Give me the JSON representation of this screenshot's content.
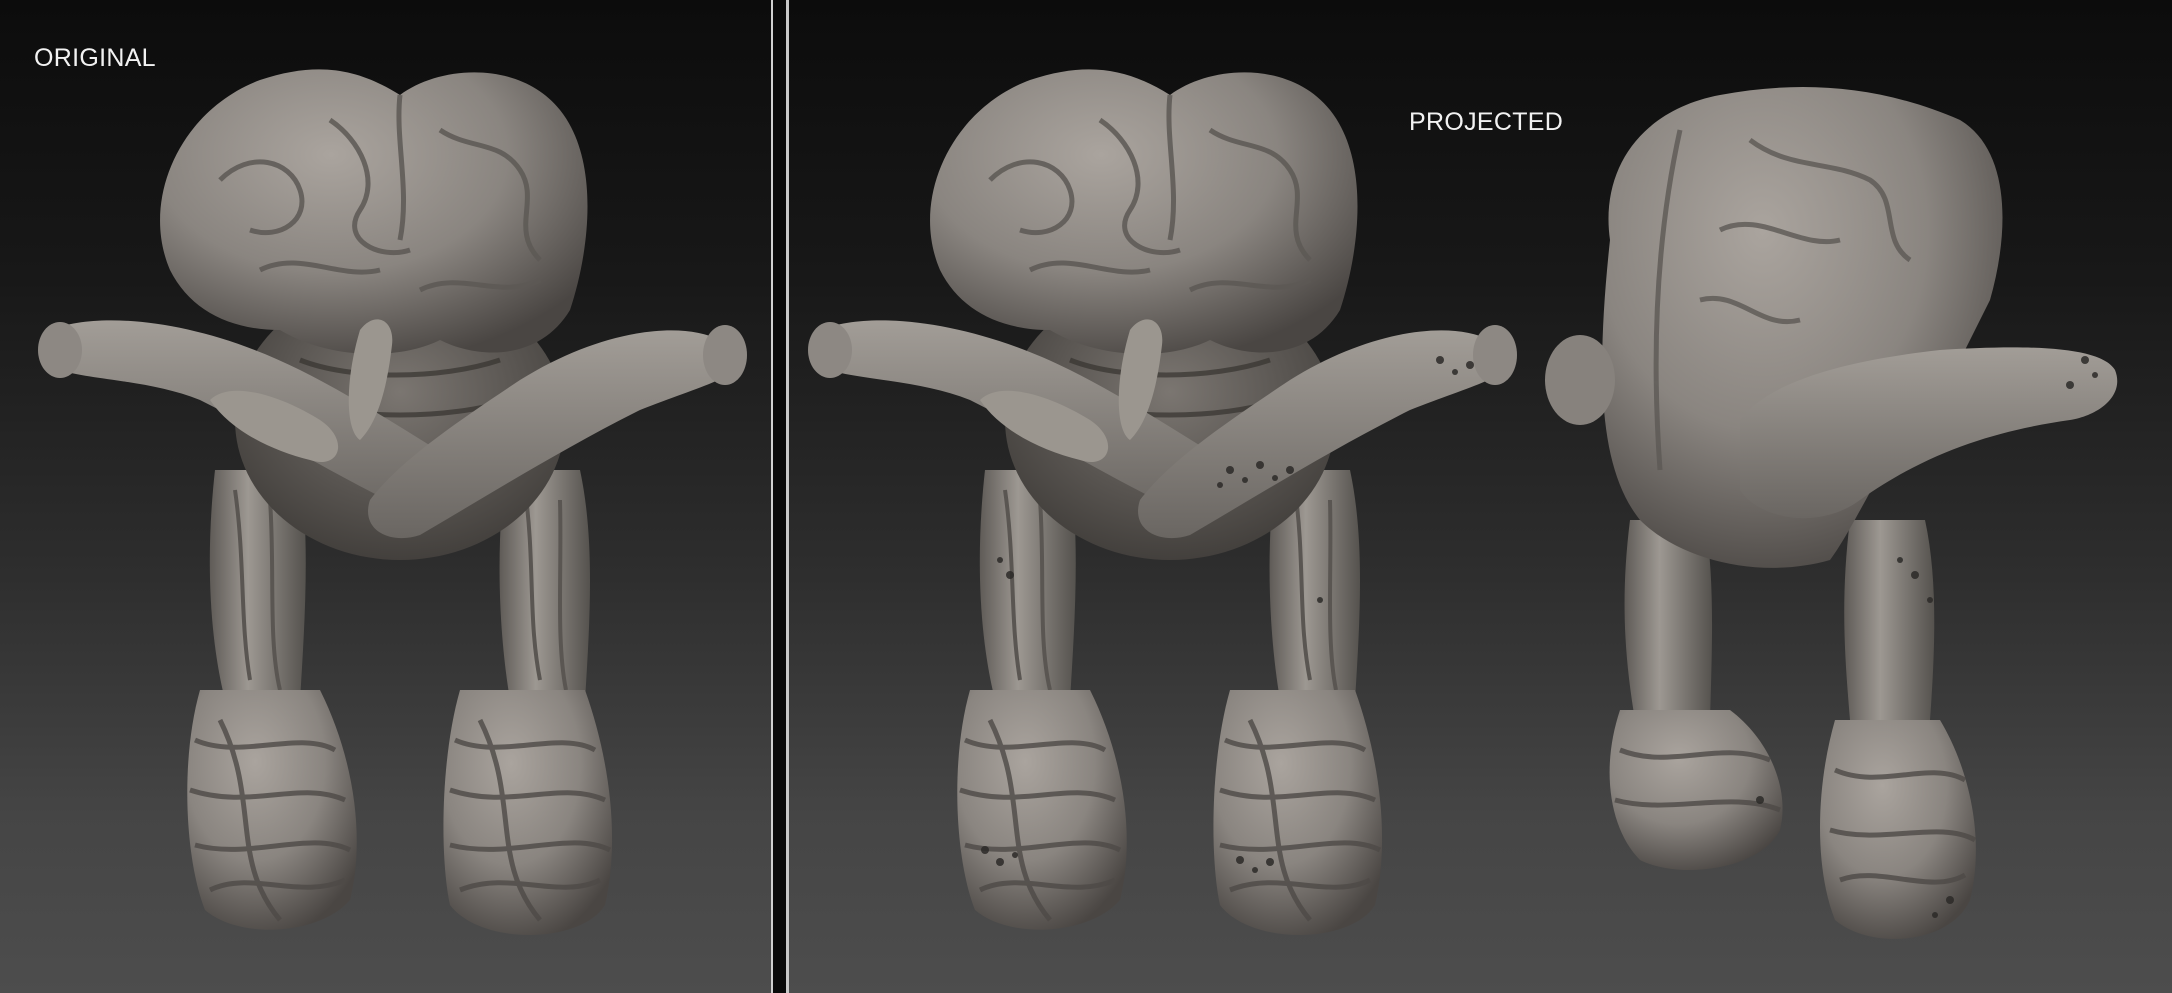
{
  "labels": {
    "original": "ORIGINAL",
    "projected": "PROJECTED"
  },
  "colors": {
    "background_top": "#0c0c0c",
    "background_bottom": "#4d4d4d",
    "clay": "#8a8580",
    "clay_highlight": "#aaa49e",
    "clay_shadow": "#3e3b38",
    "divider": "#d0d0d0"
  },
  "scenes": [
    {
      "name": "original-front-view",
      "subject": "sculpted creature with brain-like head, crossed arms and wrapped legs"
    },
    {
      "name": "projected-front-view",
      "subject": "same sculpt after detail projection, showing artifacts"
    },
    {
      "name": "projected-side-view",
      "subject": "same sculpt rotated, back and arm visible"
    }
  ]
}
